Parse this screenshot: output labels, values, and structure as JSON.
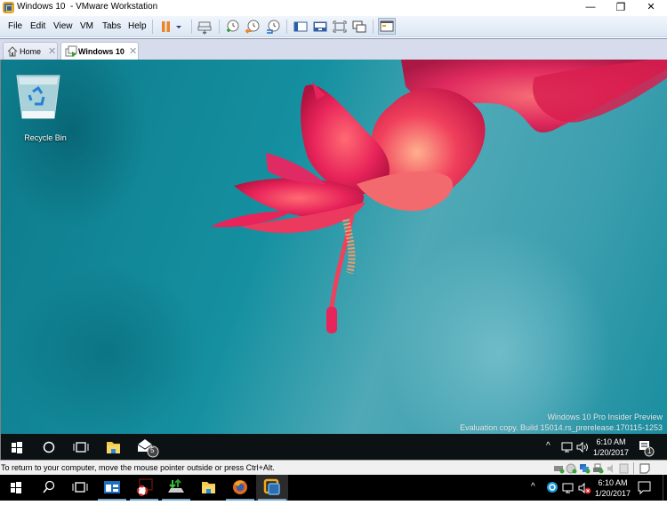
{
  "window": {
    "title": "Windows 10  - VMware Workstation",
    "controls": [
      "minimize",
      "restore",
      "close"
    ],
    "minimize_glyph": "—",
    "restore_glyph": "❐",
    "close_glyph": "✕"
  },
  "menu": {
    "items": [
      "File",
      "Edit",
      "View",
      "VM",
      "Tabs",
      "Help"
    ]
  },
  "toolbar": {
    "buttons": [
      {
        "name": "pause-icon"
      },
      {
        "name": "power-dropdown-icon"
      },
      {
        "name": "send-ctrl-alt-del-icon"
      },
      {
        "name": "take-snapshot-icon"
      },
      {
        "name": "revert-snapshot-icon"
      },
      {
        "name": "snapshot-manager-icon"
      },
      {
        "name": "show-library-icon"
      },
      {
        "name": "thumbnail-bar-icon"
      },
      {
        "name": "full-screen-icon"
      },
      {
        "name": "unity-icon"
      },
      {
        "name": "console-view-icon"
      }
    ]
  },
  "tabs": [
    {
      "label": "Home",
      "active": false,
      "close": "✕"
    },
    {
      "label": "Windows 10",
      "active": true,
      "close": "✕"
    }
  ],
  "guest": {
    "desktop_icons": [
      {
        "label": "Recycle Bin"
      }
    ],
    "watermark": {
      "line1": "Windows 10 Pro Insider Preview",
      "line2": "Evaluation copy. Build 15014.rs_prerelease.170115-1253"
    },
    "taskbar": {
      "apps": [
        "start",
        "cortana",
        "task-view",
        "file-explorer",
        "mail"
      ],
      "mail_badge": "5",
      "tray": {
        "chevron": "^",
        "time": "6:10 AM",
        "date": "1/20/2017",
        "notification_badge": "1"
      }
    }
  },
  "statusbar": {
    "message": "To return to your computer, move the mouse pointer outside or press Ctrl+Alt.",
    "devices": [
      "hard-disk",
      "cd-dvd",
      "network-adapter",
      "printer",
      "sound-card",
      "display",
      "message-log"
    ]
  },
  "host_taskbar": {
    "apps": [
      "start",
      "search",
      "task-view",
      "app-window",
      "help-lifesaver",
      "transfer-app",
      "file-explorer",
      "firefox",
      "vmware-workstation"
    ],
    "tray": {
      "chevron": "^",
      "time": "6:10 AM",
      "date": "1/20/2017"
    }
  },
  "colors": {
    "accent_orange": "#e8862a",
    "desktop_teal": "#1590a0",
    "flower_pink": "#e8245a",
    "taskbar_dark": "#0c1114"
  }
}
